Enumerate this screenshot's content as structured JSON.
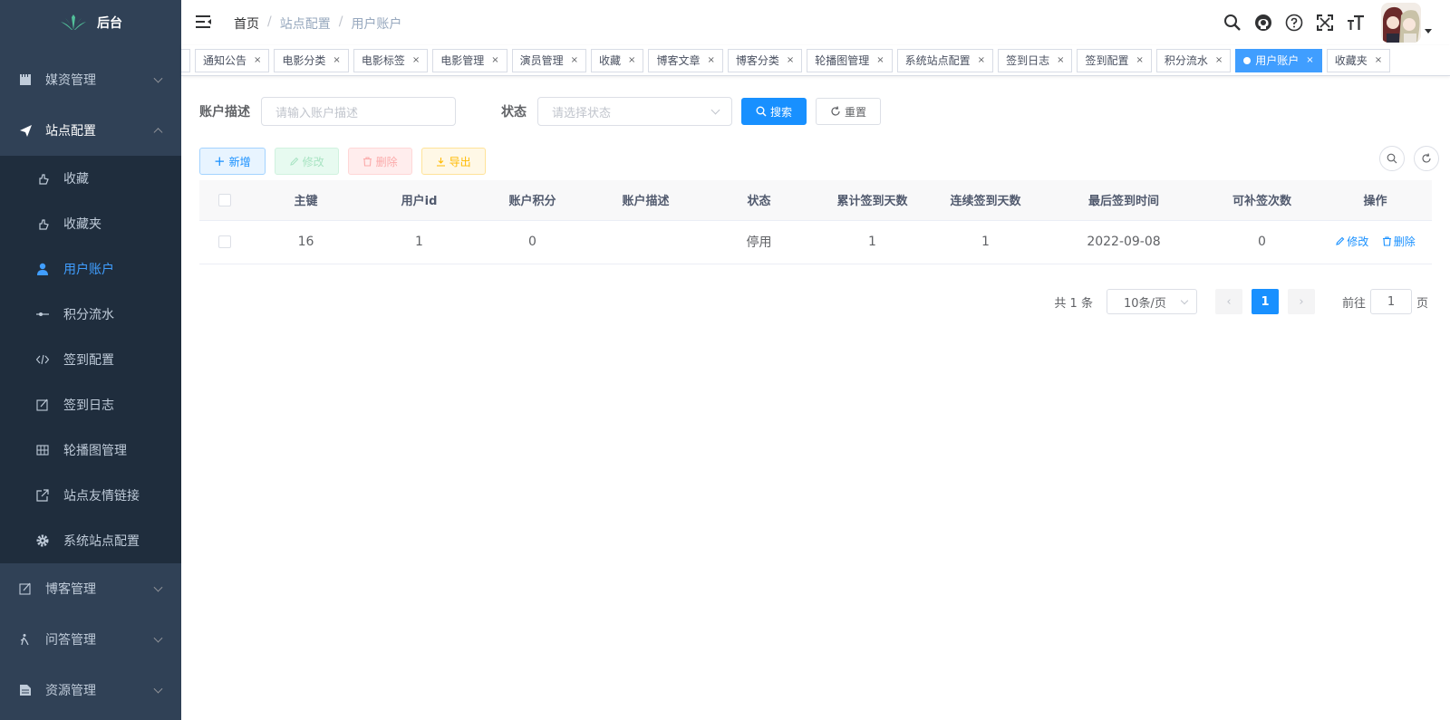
{
  "app": {
    "logo_text": "后台"
  },
  "sidebar": {
    "menus": [
      {
        "label": "媒资管理",
        "icon": "film-icon"
      },
      {
        "label": "站点配置",
        "icon": "send-icon"
      },
      {
        "label": "博客管理",
        "icon": "edit-icon"
      },
      {
        "label": "问答管理",
        "icon": "guide-icon"
      },
      {
        "label": "资源管理",
        "icon": "document-icon"
      }
    ],
    "subitems": [
      {
        "label": "收藏",
        "icon": "hand-icon"
      },
      {
        "label": "收藏夹",
        "icon": "hand-icon"
      },
      {
        "label": "用户账户",
        "icon": "user-icon"
      },
      {
        "label": "积分流水",
        "icon": "commit-icon"
      },
      {
        "label": "签到配置",
        "icon": "code-icon"
      },
      {
        "label": "签到日志",
        "icon": "form-icon"
      },
      {
        "label": "轮播图管理",
        "icon": "grid-icon"
      },
      {
        "label": "站点友情链接",
        "icon": "link-icon"
      },
      {
        "label": "系统站点配置",
        "icon": "gear-icon"
      }
    ]
  },
  "breadcrumb": [
    "首页",
    "站点配置",
    "用户账户"
  ],
  "tags": [
    "通知公告",
    "电影分类",
    "电影标签",
    "电影管理",
    "演员管理",
    "收藏",
    "博客文章",
    "博客分类",
    "轮播图管理",
    "系统站点配置",
    "签到日志",
    "签到配置",
    "积分流水",
    "用户账户",
    "收藏夹"
  ],
  "active_tag": "用户账户",
  "search": {
    "desc_label": "账户描述",
    "desc_placeholder": "请输入账户描述",
    "status_label": "状态",
    "status_placeholder": "请选择状态",
    "search_btn": "搜索",
    "reset_btn": "重置"
  },
  "toolbar": {
    "add": "新增",
    "edit": "修改",
    "delete": "删除",
    "export": "导出"
  },
  "table": {
    "columns": [
      "主键",
      "用户id",
      "账户积分",
      "账户描述",
      "状态",
      "累计签到天数",
      "连续签到天数",
      "最后签到时间",
      "可补签次数",
      "操作"
    ],
    "rows": [
      {
        "id": "16",
        "user_id": "1",
        "points": "0",
        "desc": "",
        "status": "停用",
        "total_days": "1",
        "continuous_days": "1",
        "last_time": "2022-09-08",
        "makeup": "0",
        "edit": "修改",
        "delete": "删除"
      }
    ]
  },
  "pagination": {
    "total_text": "共 1 条",
    "page_size": "10条/页",
    "current": "1",
    "goto_label": "前往",
    "goto_value": "1",
    "page_suffix": "页"
  },
  "colors": {
    "sidebar_bg": "#304156",
    "submenu_bg": "#1f2d3d",
    "primary": "#1890ff",
    "active_tag": "#409eff"
  }
}
